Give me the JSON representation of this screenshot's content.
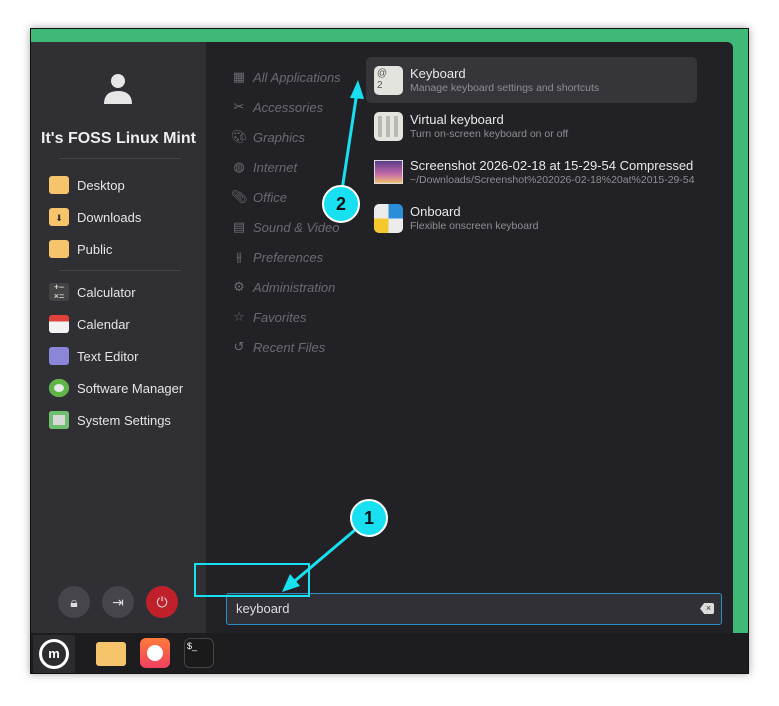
{
  "user": {
    "name": "It's FOSS Linux Mint"
  },
  "places": [
    {
      "label": "Desktop"
    },
    {
      "label": "Downloads"
    },
    {
      "label": "Public"
    }
  ],
  "favorites": [
    {
      "label": "Calculator"
    },
    {
      "label": "Calendar"
    },
    {
      "label": "Text Editor"
    },
    {
      "label": "Software Manager"
    },
    {
      "label": "System Settings"
    }
  ],
  "categories": [
    {
      "label": "All Applications",
      "icon": "grid"
    },
    {
      "label": "Accessories",
      "icon": "tools"
    },
    {
      "label": "Graphics",
      "icon": "palette"
    },
    {
      "label": "Internet",
      "icon": "globe"
    },
    {
      "label": "Office",
      "icon": "paperclip"
    },
    {
      "label": "Sound & Video",
      "icon": "film"
    },
    {
      "label": "Preferences",
      "icon": "sliders"
    },
    {
      "label": "Administration",
      "icon": "gear"
    },
    {
      "label": "Favorites",
      "icon": "star"
    },
    {
      "label": "Recent Files",
      "icon": "history"
    }
  ],
  "results": [
    {
      "title": "Keyboard",
      "subtitle": "Manage keyboard settings and shortcuts"
    },
    {
      "title": "Virtual keyboard",
      "subtitle": "Turn on-screen keyboard on or off"
    },
    {
      "title": "Screenshot 2026-02-18 at 15-29-54 Compressed",
      "subtitle": "~/Downloads/Screenshot%202026-02-18%20at%2015-29-54"
    },
    {
      "title": "Onboard",
      "subtitle": "Flexible onscreen keyboard"
    }
  ],
  "keyboard_icon": {
    "top": "@",
    "bottom": "2"
  },
  "search": {
    "value": "keyboard"
  },
  "annotations": {
    "one": "1",
    "two": "2"
  },
  "terminal_icon": "$_",
  "colors": {
    "accent": "#19e0f0",
    "power": "#c0202a",
    "desktop_green": "#3fb878"
  }
}
